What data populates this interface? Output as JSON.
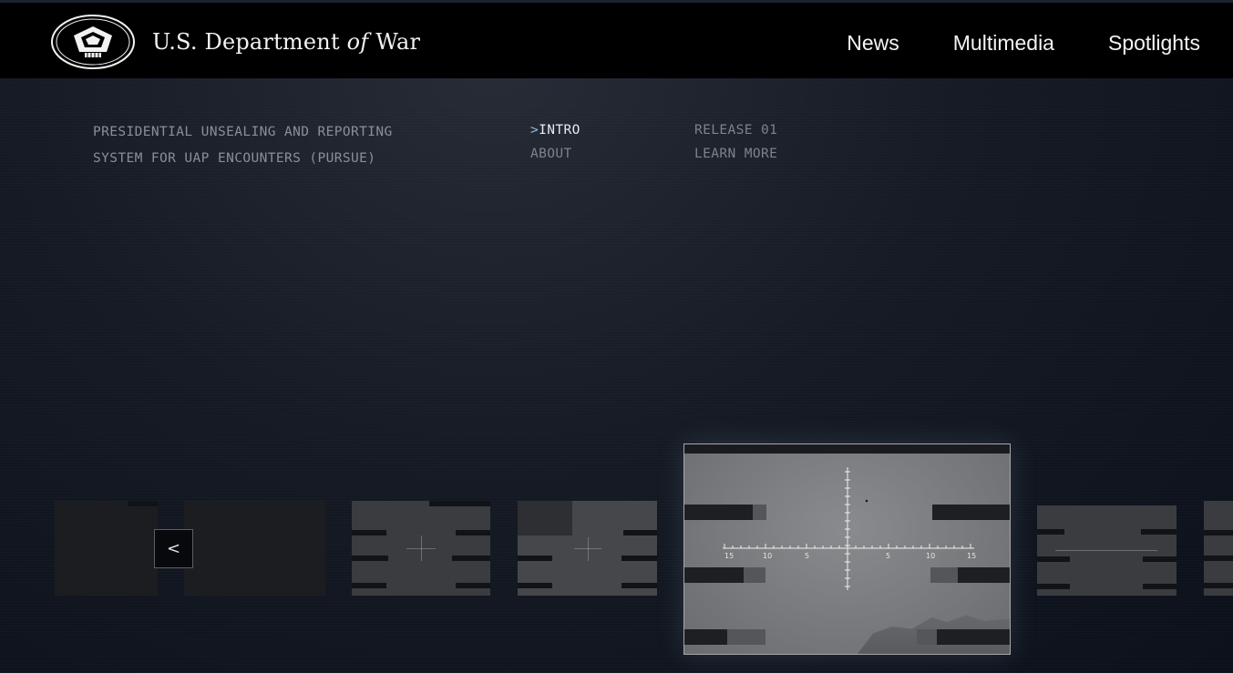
{
  "header": {
    "logo_alt": "Pentagon seal",
    "site_title_pre": "U.S. Department",
    "site_title_of": "of",
    "site_title_post": "War",
    "nav": [
      {
        "label": "News"
      },
      {
        "label": "Multimedia"
      },
      {
        "label": "Spotlights"
      }
    ]
  },
  "intro": {
    "title_line1": "PRESIDENTIAL UNSEALING AND REPORTING",
    "title_line2": "SYSTEM FOR UAP ENCOUNTERS (PURSUE)",
    "menu_col1": [
      {
        "caret": ">",
        "label": "INTRO",
        "active": true
      },
      {
        "label": "ABOUT",
        "active": false
      }
    ],
    "menu_col2": [
      {
        "label": "RELEASE 01"
      },
      {
        "label": "LEARN MORE"
      }
    ]
  },
  "carousel": {
    "prev_label": "<",
    "featured_scale_labels": [
      "15",
      "10",
      "5",
      "5",
      "10",
      "15"
    ]
  },
  "colors": {
    "header_bg": "#000000",
    "page_bg": "#151a24",
    "active_caret": "#9bbbe0"
  }
}
